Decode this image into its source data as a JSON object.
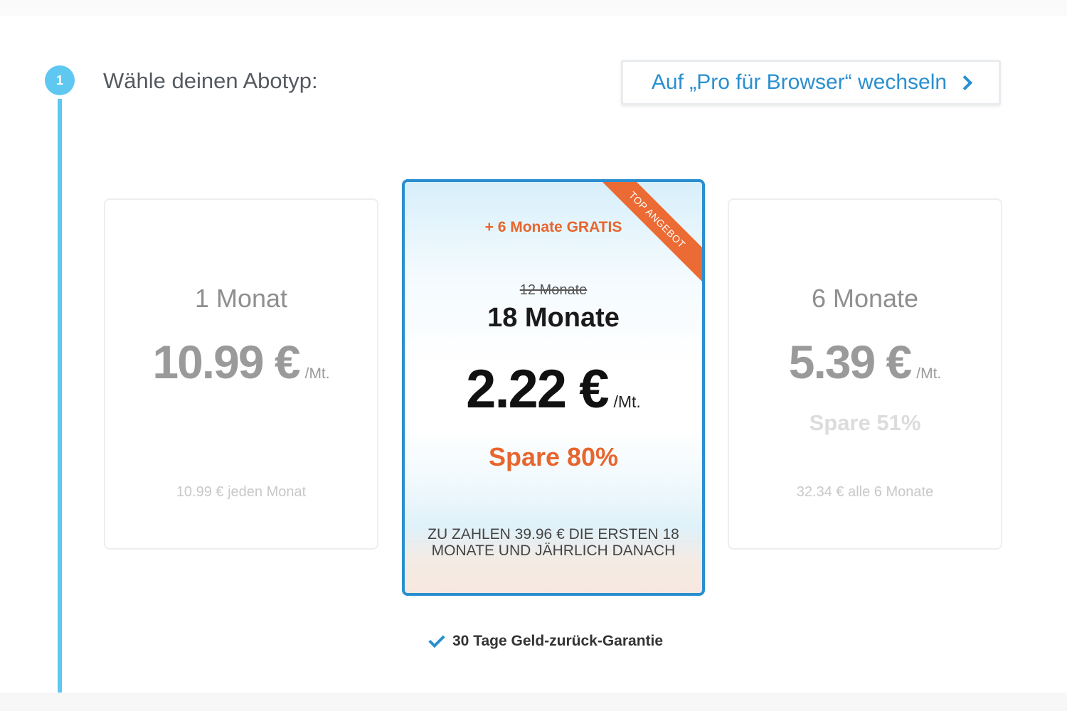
{
  "step": {
    "number": "1",
    "title": "Wähle deinen Abotyp:"
  },
  "switch_button": {
    "label": "Auf „Pro für Browser“ wechseln"
  },
  "plans": [
    {
      "name": "1 Monat",
      "price": "10.99 €",
      "unit": "/Mt.",
      "saving": "",
      "note": "10.99 € jeden Monat"
    },
    {
      "ribbon": "TOP ANGEBOT",
      "bonus": "+ 6 Monate GRATIS",
      "old_duration": "12 Monate",
      "name": "18 Monate",
      "price": "2.22 €",
      "unit": "/Mt.",
      "saving": "Spare 80%",
      "note": "ZU ZAHLEN 39.96 € DIE ERSTEN 18 MONATE UND JÄHRLICH DANACH",
      "selected": true
    },
    {
      "name": "6 Monate",
      "price": "5.39 €",
      "unit": "/Mt.",
      "saving": "Spare 51%",
      "note": "32.34 € alle 6 Monate"
    }
  ],
  "guarantee": {
    "text": "30 Tage Geld-zurück-Garantie"
  },
  "colors": {
    "accent_blue": "#2a8fd0",
    "step_blue": "#5ec8f0",
    "accent_orange": "#e8652e"
  }
}
